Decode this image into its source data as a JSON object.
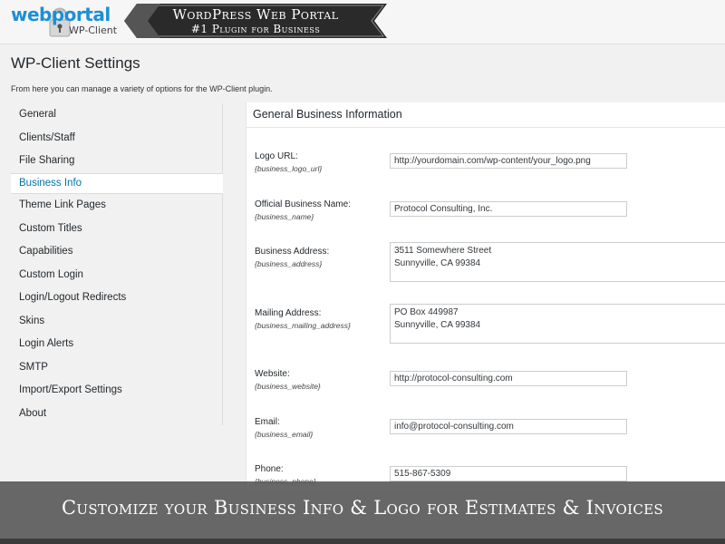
{
  "brand": {
    "logo_web": "web",
    "logo_portal": "portal",
    "logo_sub": "WP-Client",
    "banner_title": "WordPress Web Portal",
    "banner_sub": "#1 Plugin for Business"
  },
  "page": {
    "title": "WP-Client Settings",
    "description": "From here you can manage a variety of options for the WP-Client plugin."
  },
  "nav": {
    "items": [
      {
        "label": "General"
      },
      {
        "label": "Clients/Staff"
      },
      {
        "label": "File Sharing"
      },
      {
        "label": "Business Info"
      },
      {
        "label": "Theme Link Pages"
      },
      {
        "label": "Custom Titles"
      },
      {
        "label": "Capabilities"
      },
      {
        "label": "Custom Login"
      },
      {
        "label": "Login/Logout Redirects"
      },
      {
        "label": "Skins"
      },
      {
        "label": "Login Alerts"
      },
      {
        "label": "SMTP"
      },
      {
        "label": "Import/Export Settings"
      },
      {
        "label": "About"
      }
    ],
    "active": "Business Info"
  },
  "panel": {
    "heading": "General Business Information",
    "fields": {
      "logo": {
        "label": "Logo URL:",
        "key": "{business_logo_url}",
        "value": "http://yourdomain.com/wp-content/your_logo.png"
      },
      "name": {
        "label": "Official Business Name:",
        "key": "{business_name}",
        "value": "Protocol Consulting, Inc."
      },
      "address": {
        "label": "Business Address:",
        "key": "{business_address}",
        "line1": "3511 Somewhere Street",
        "line2": "Sunnyville, CA 99384"
      },
      "mailing": {
        "label": "Mailing Address:",
        "key": "{business_mailing_address}",
        "line1": "PO Box 449987",
        "line2": "Sunnyville, CA 99384"
      },
      "website": {
        "label": "Website:",
        "key": "{business_website}",
        "value": "http://protocol-consulting.com"
      },
      "email": {
        "label": "Email:",
        "key": "{business_email}",
        "value": "info@protocol-consulting.com"
      },
      "phone": {
        "label": "Phone:",
        "key": "{business_phone}",
        "value": "515-867-5309"
      }
    }
  },
  "caption": {
    "text": "Customize your Business Info & Logo for Estimates & Invoices"
  },
  "colors": {
    "accent": "#0073aa",
    "logo_blue": "#1c8fd6",
    "banner_dark": "#2a2a2a",
    "caption_bg": "#5c5c5c"
  },
  "icons": [
    "lock-icon"
  ]
}
